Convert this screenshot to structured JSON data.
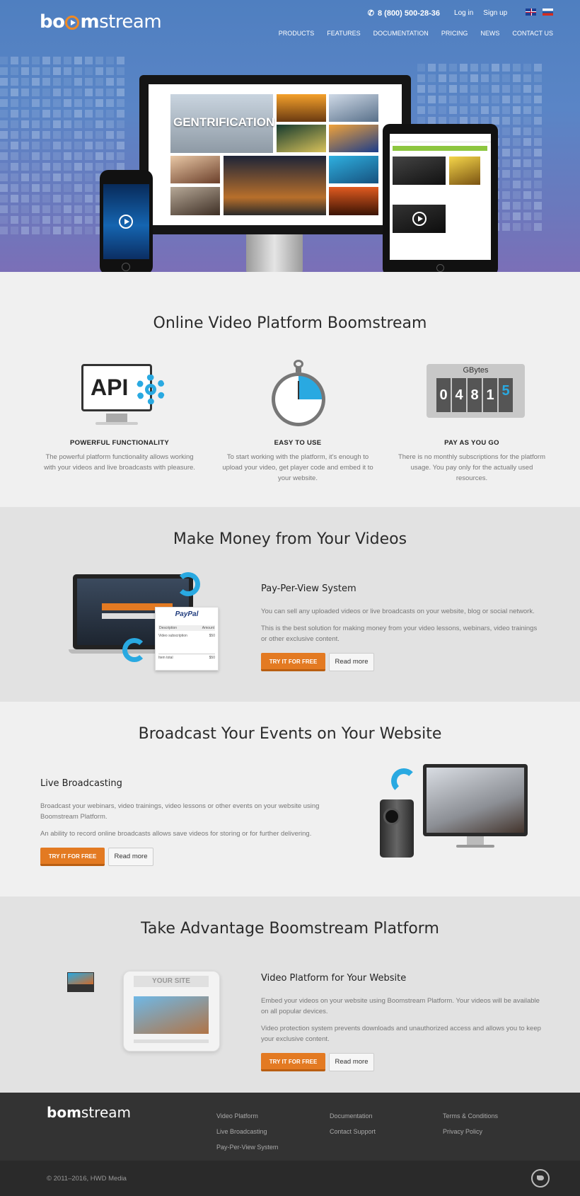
{
  "header": {
    "logo": "boomstream",
    "phone": "8 (800) 500-28-36",
    "login": "Log in",
    "signup": "Sign up",
    "nav": [
      "PRODUCTS",
      "FEATURES",
      "DOCUMENTATION",
      "PRICING",
      "NEWS",
      "CONTACT US"
    ]
  },
  "hero": {
    "screen_title": "GENTRIFICATION"
  },
  "platform": {
    "title": "Online Video Platform Boomstream",
    "api_label": "API",
    "gbytes_label": "GBytes",
    "gbytes_digits": [
      "0",
      "4",
      "8",
      "1",
      "5"
    ],
    "features": [
      {
        "title": "POWERFUL FUNCTIONALITY",
        "text": "The powerful platform functionality allows working with your videos and live broadcasts with pleasure."
      },
      {
        "title": "EASY TO USE",
        "text": "To start working with the platform, it's enough to upload your video, get player code and embed it to your website."
      },
      {
        "title": "PAY AS YOU GO",
        "text": "There is no monthly subscriptions for the platform usage. You pay only for the actually used resources."
      }
    ]
  },
  "money": {
    "title": "Make Money from Your Videos",
    "subtitle": "Pay-Per-View System",
    "p1": "You can sell any uploaded videos or live broadcasts on your website, blog or social network.",
    "p2": "This is the best solution for making money from your video lessons, webinars, video trainings or other exclusive content.",
    "paypal": "PayPal",
    "invoice_desc": "Description",
    "invoice_amount": "Amount",
    "invoice_item": "Video subscription",
    "invoice_price": "$50",
    "invoice_total": "Item total",
    "invoice_total_val": "$50"
  },
  "broadcast": {
    "title": "Broadcast Your Events on Your Website",
    "subtitle": "Live Broadcasting",
    "p1": "Broadcast your webinars, video trainings, video lessons or other events on your website using Boomstream Platform.",
    "p2": "An ability to record online broadcasts allows save videos for storing or for further delivering."
  },
  "advantage": {
    "title": "Take Advantage Boomstream Platform",
    "subtitle": "Video Platform for Your Website",
    "p1": "Embed your videos on your website using Boomstream Platform. Your videos will be available on all popular devices.",
    "p2": "Video protection system prevents downloads and unauthorized access and allows you to keep your exclusive content.",
    "your_site": "YOUR SITE"
  },
  "buttons": {
    "try": "TRY IT FOR FREE",
    "read": "Read more"
  },
  "footer": {
    "logo": "boomstream",
    "col1": [
      "Video Platform",
      "Live Broadcasting",
      "Pay-Per-View System"
    ],
    "col2": [
      "Documentation",
      "Contact Support"
    ],
    "col3": [
      "Terms & Conditions",
      "Privacy Policy"
    ],
    "copyright": "© 2011–2016, HWD Media"
  },
  "colors": {
    "accent_orange": "#e37a22",
    "accent_blue": "#29a9e1",
    "hero_blue": "#4f7fc0",
    "footer_dark": "#333333"
  }
}
